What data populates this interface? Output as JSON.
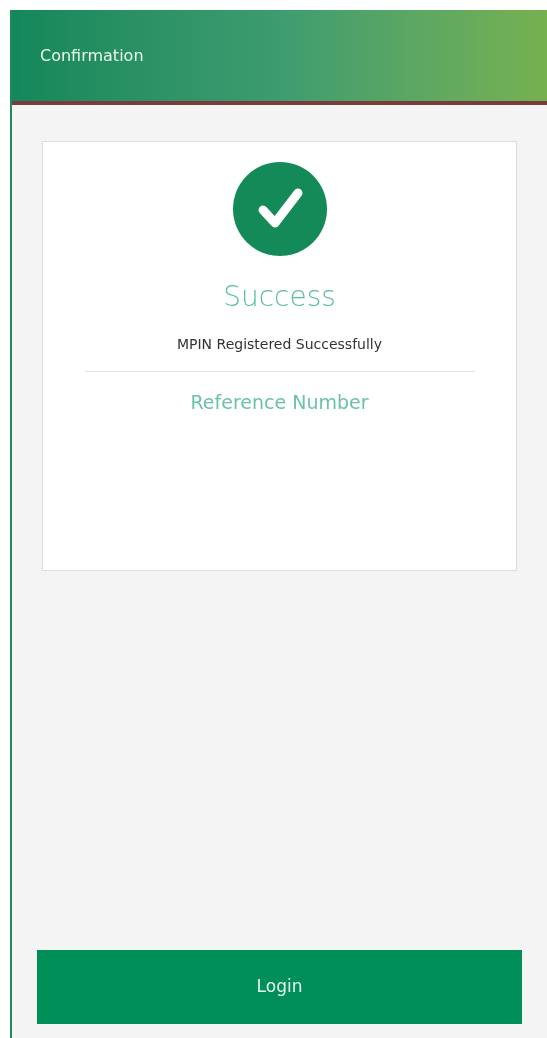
{
  "header": {
    "title": "Confirmation"
  },
  "result": {
    "status": "Success",
    "message": "MPIN Registered Successfully",
    "reference_label": "Reference Number"
  },
  "buttons": [
    {
      "label": "Login"
    }
  ]
}
